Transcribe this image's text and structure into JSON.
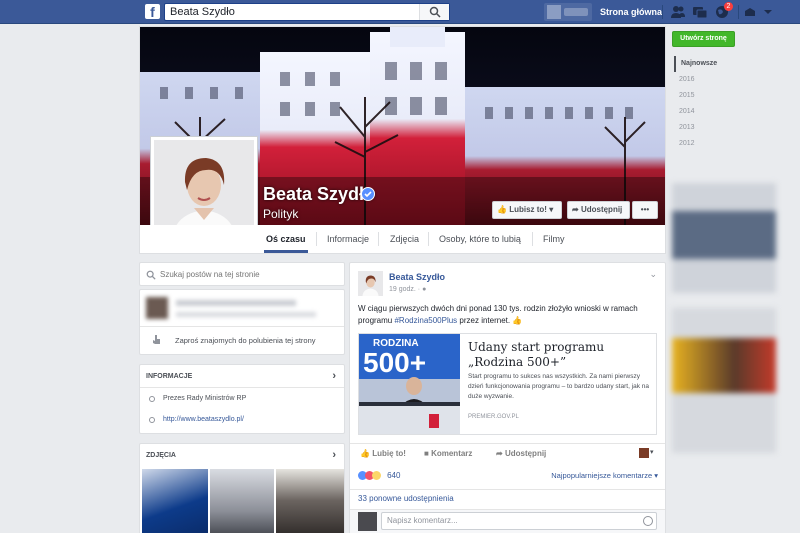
{
  "topbar": {
    "logo": "f",
    "search_value": "Beata Szydło",
    "home_label": "Strona główna",
    "notification_count": "2"
  },
  "page": {
    "name": "Beata Szydło",
    "category": "Polityk",
    "like_button": "Lubisz to!",
    "share_button": "Udostępnij",
    "more_button": "•••"
  },
  "tabs": [
    "Oś czasu",
    "Informacje",
    "Zdjęcia",
    "Osoby, które to lubią",
    "Filmy"
  ],
  "left": {
    "search_placeholder": "Szukaj postów na tej stronie",
    "invite_label": "Zaproś znajomych do polubienia tej strony",
    "info_header": "INFORMACJE",
    "info_items": [
      "Prezes Rady Ministrów RP",
      "http://www.beataszydlo.pl/"
    ],
    "photos_header": "ZDJĘCIA"
  },
  "right": {
    "create_page_button": "Utwórz stronę",
    "years": [
      "Najnowsze",
      "2016",
      "2015",
      "2014",
      "2013",
      "2012"
    ]
  },
  "post": {
    "author": "Beata Szydło",
    "time": "19 godz.",
    "text_before": "W ciągu pierwszych dwóch dni ponad 130 tys. rodzin złożyło wnioski w ramach programu ",
    "hashtag": "#Rodzina500Plus",
    "text_after": " przez internet.",
    "link_title": "Udany start programu „Rodzina 500+”",
    "link_desc": "Start programu to sukces nas wszystkich. Za nami pierwszy dzień funkcjonowania programu – to bardzo udany start, jak na duże wyzwanie.",
    "link_source": "PREMIER.GOV.PL",
    "link_image_text": "RODZINA",
    "link_image_number": "500+",
    "like_action": "Lubię to!",
    "comment_action": "Komentarz",
    "share_action": "Udostępnij",
    "reaction_count": "640",
    "sort_label": "Najpopularniejsze komentarze ▾",
    "shares_label": "33 ponowne udostępnienia",
    "comment_placeholder": "Napisz komentarz..."
  },
  "colors": {
    "brand": "#3b5998",
    "link": "#365899",
    "create_green": "#42b72a",
    "notification_red": "#fa3e3e"
  }
}
